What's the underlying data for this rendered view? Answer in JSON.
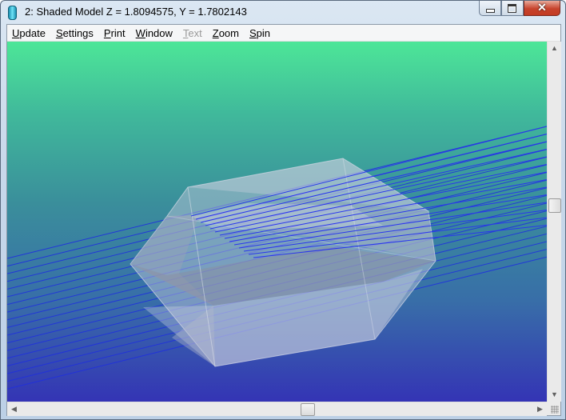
{
  "window": {
    "title": "2: Shaded Model Z = 1.8094575, Y = 1.7802143",
    "close_glyph": "✕"
  },
  "menu": {
    "items": [
      {
        "label": "Update",
        "enabled": true
      },
      {
        "label": "Settings",
        "enabled": true
      },
      {
        "label": "Print",
        "enabled": true
      },
      {
        "label": "Window",
        "enabled": true
      },
      {
        "label": "Text",
        "enabled": false
      },
      {
        "label": "Zoom",
        "enabled": true
      },
      {
        "label": "Spin",
        "enabled": true
      }
    ]
  },
  "scrollbars": {
    "up_arrow": "▲",
    "down_arrow": "▼",
    "left_arrow": "◀",
    "right_arrow": "▶"
  },
  "colors": {
    "background_top": "#4de698",
    "background_bottom": "#3434b5",
    "wire_lines": "#1f2ee0",
    "model_faces": "#c8ccdd"
  },
  "icons": {
    "app": "app-icon",
    "minimize": "minimize-icon",
    "maximize": "maximize-icon",
    "close": "close-icon",
    "resize_grip": "resize-grip-icon"
  }
}
